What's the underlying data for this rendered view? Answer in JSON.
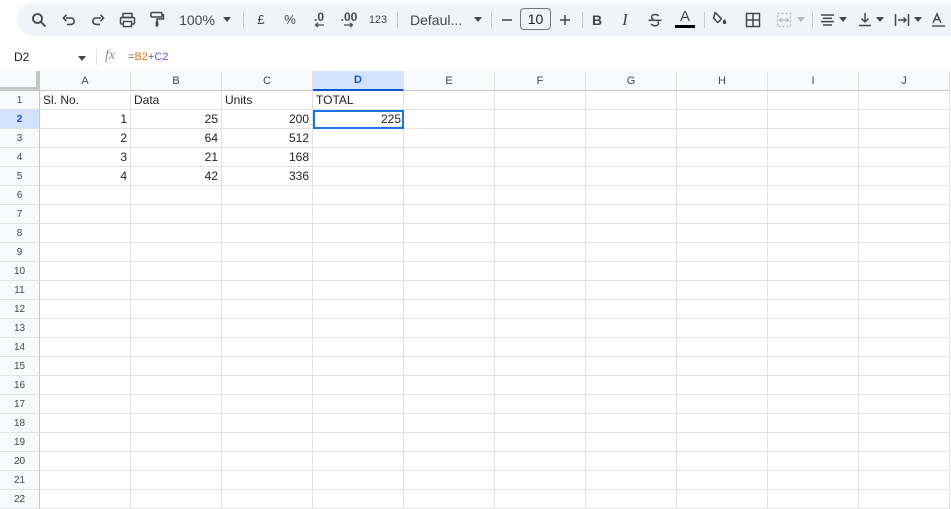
{
  "toolbar": {
    "zoom": "100%",
    "currency_label": "£",
    "percent_label": "%",
    "decrease_decimal_label": ".0",
    "increase_decimal_label": ".00",
    "format_label": "123",
    "font": "Defaul...",
    "font_size": "10",
    "bold_label": "B",
    "italic_label": "I",
    "text_color_label": "A",
    "text_color": "#000000"
  },
  "formula_bar": {
    "cell_ref": "D2",
    "fx_label": "fx",
    "formula_prefix": "=",
    "ref1": "B2",
    "operator": "+",
    "ref2": "C2"
  },
  "grid": {
    "columns": [
      "A",
      "B",
      "C",
      "D",
      "E",
      "F",
      "G",
      "H",
      "I",
      "J"
    ],
    "active_column": "D",
    "active_row": 2,
    "row_numbers": [
      "1",
      "2",
      "3",
      "4",
      "5",
      "6",
      "7",
      "8",
      "9",
      "10",
      "11",
      "12",
      "13",
      "14",
      "15",
      "16",
      "17",
      "18",
      "19",
      "20",
      "21",
      "22"
    ],
    "rows": [
      [
        "Sl. No.",
        "Data",
        "Units",
        "TOTAL",
        "",
        "",
        "",
        "",
        "",
        ""
      ],
      [
        "1",
        "25",
        "200",
        "225",
        "",
        "",
        "",
        "",
        "",
        ""
      ],
      [
        "2",
        "64",
        "512",
        "",
        "",
        "",
        "",
        "",
        "",
        ""
      ],
      [
        "3",
        "21",
        "168",
        "",
        "",
        "",
        "",
        "",
        "",
        ""
      ],
      [
        "4",
        "42",
        "336",
        "",
        "",
        "",
        "",
        "",
        "",
        ""
      ]
    ]
  },
  "colors": {
    "accent": "#1a73e8",
    "header_active_bg": "#d3e3fd",
    "ref1_color": "#e8710a",
    "ref2_color": "#7b4fc9"
  }
}
